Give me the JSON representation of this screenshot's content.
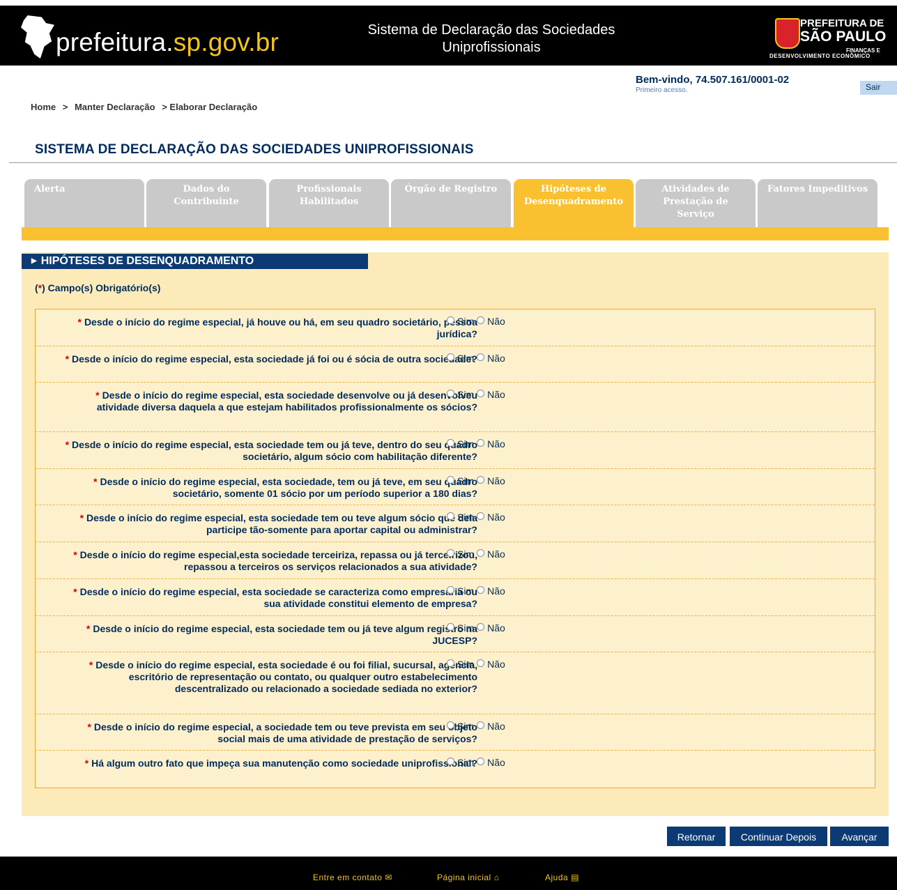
{
  "header": {
    "logo_text_1": "prefeitura.",
    "logo_text_2": "sp.gov.br",
    "system_title": "Sistema de Declaração das Sociedades Uniprofissionais",
    "pref_line1": "PREFEITURA DE",
    "pref_line2": "SÃO PAULO",
    "pref_line3": "FINANÇAS E",
    "pref_line4": "DESENVOLVIMENTO ECONÔMICO"
  },
  "user": {
    "welcome": "Bem-vindo, 74.507.161/0001-02",
    "first_access": "Primeiro acesso.",
    "logout": "Sair"
  },
  "breadcrumb": [
    "Home",
    ">",
    "Manter Declaração",
    "> Elaborar Declaração"
  ],
  "page_title": "SISTEMA DE DECLARAÇÃO DAS SOCIEDADES UNIPROFISSIONAIS",
  "tabs": [
    {
      "label": "Alerta"
    },
    {
      "label": "Dados do Contribuinte"
    },
    {
      "label": "Profissionais Habilitados"
    },
    {
      "label": "Órgão de Registro"
    },
    {
      "label": "Hipóteses de Desenquadramento",
      "active": true
    },
    {
      "label": "Atividades de Prestação de Serviço"
    },
    {
      "label": "Fatores Impeditivos"
    }
  ],
  "section": {
    "title": "HIPÓTESES DE DESENQUADRAMENTO",
    "mandatory_open": "(",
    "mandatory_star": "*",
    "mandatory_close": ") Campo(s) Obrigatório(s)"
  },
  "options": {
    "yes": "Sim",
    "no": "Não"
  },
  "questions": [
    "Desde o início do regime especial, já houve ou há, em seu quadro societário, pessoa jurídica?",
    "Desde o início do regime especial, esta sociedade já foi ou é sócia de outra sociedade?",
    "Desde o início do regime especial, esta sociedade desenvolve ou já desenvolveu atividade diversa daquela a que estejam habilitados profissionalmente os sócios?",
    "Desde o início do regime especial, esta sociedade tem ou já teve, dentro do seu quadro societário, algum sócio com habilitação diferente?",
    "Desde o início do regime especial, esta sociedade, tem ou já teve, em seu quadro societário, somente 01 sócio por um período superior a 180 dias?",
    "Desde o início do regime especial, esta sociedade tem ou teve algum sócio que dela participe tão-somente para aportar capital ou administrar?",
    "Desde o início do regime especial,esta sociedade terceiriza, repassa ou já terceirizou, repassou a terceiros os serviços relacionados a sua atividade?",
    "Desde o início do regime especial, esta sociedade se caracteriza como empresária ou sua atividade constitui elemento de empresa?",
    "Desde o início do regime especial, esta sociedade tem ou já teve algum registro na JUCESP?",
    "Desde o início do regime especial, esta sociedade é ou foi filial, sucursal, agência, escritório de representação ou contato, ou qualquer outro estabelecimento descentralizado ou relacionado a sociedade sediada no exterior?",
    "Desde o início do regime especial, a sociedade tem ou teve prevista em seu objeto social mais de uma atividade de prestação de serviços?",
    "Há algum outro fato que impeça sua manutenção como sociedade uniprofissional?"
  ],
  "buttons": {
    "back": "Retornar",
    "later": "Continuar Depois",
    "next": "Avançar"
  },
  "footer": {
    "contact": "Entre em contato",
    "home": "Página inicial",
    "help": "Ajuda"
  },
  "colors": {
    "header_bg": "#000000",
    "accent_yellow": "#f9c12f",
    "navy": "#0b3a74",
    "panel_bg": "#fcebb8",
    "required_star": "#dd0000"
  }
}
